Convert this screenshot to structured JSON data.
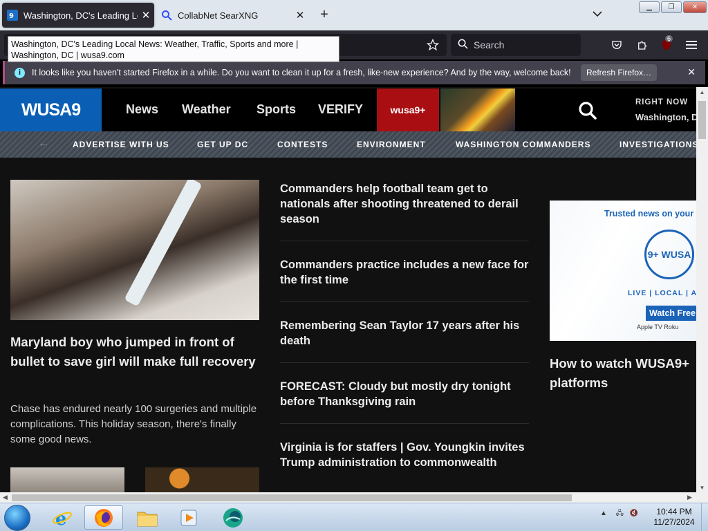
{
  "browser": {
    "tabs": [
      {
        "title": "Washington, DC's Leading Local News: Weather, Traffic, Sports and more | Washington, DC | wusa9.com",
        "active": true
      },
      {
        "title": "CollabNet SearXNG",
        "active": false
      }
    ],
    "tooltip": "Washington, DC's Leading Local News: Weather, Traffic, Sports and more | Washington, DC | wusa9.com",
    "search_placeholder": "Search",
    "extension_badge": "6",
    "notification": {
      "message": "It looks like you haven't started Firefox in a while. Do you want to clean it up for a fresh, like-new experience? And by the way, welcome back!",
      "button": "Refresh Firefox…"
    }
  },
  "site": {
    "logo": "WUSA9",
    "nav": [
      "News",
      "Weather",
      "Sports",
      "VERIFY"
    ],
    "plus_label": "wusa9+",
    "right_now": "RIGHT NOW",
    "right_now_location": "Washington, D",
    "subnav": [
      "ADVERTISE WITH US",
      "GET UP DC",
      "CONTESTS",
      "ENVIRONMENT",
      "WASHINGTON COMMANDERS",
      "INVESTIGATIONS"
    ]
  },
  "content": {
    "hero": {
      "headline": "Maryland boy who jumped in front of bullet to save girl will make full recovery",
      "description": "Chase has endured nearly 100 surgeries and multiple complications. This holiday season, there's finally some good news."
    },
    "stories": [
      "Commanders help football team get to nationals after shooting threatened to derail season",
      "Commanders practice includes a new face for the first time",
      "Remembering Sean Taylor 17 years after his death",
      "FORECAST: Cloudy but mostly dry tonight before Thanksgiving rain",
      "Virginia is for staffers | Gov. Youngkin invites Trump administration to commonwealth"
    ],
    "ad": {
      "top": "Trusted news on your",
      "circle": "9+ WUSA",
      "tags": "LIVE | LOCAL | ALWA",
      "watch": "Watch Free",
      "brands": "Apple TV  Roku",
      "caption": "How to watch WUSA9+ platforms"
    }
  },
  "taskbar": {
    "time": "10:44 PM",
    "date": "11/27/2024"
  },
  "colors": {
    "accent_blue": "#0a5fb4",
    "plus_red": "#a80e12",
    "firefox_dark": "#2b2a33"
  }
}
